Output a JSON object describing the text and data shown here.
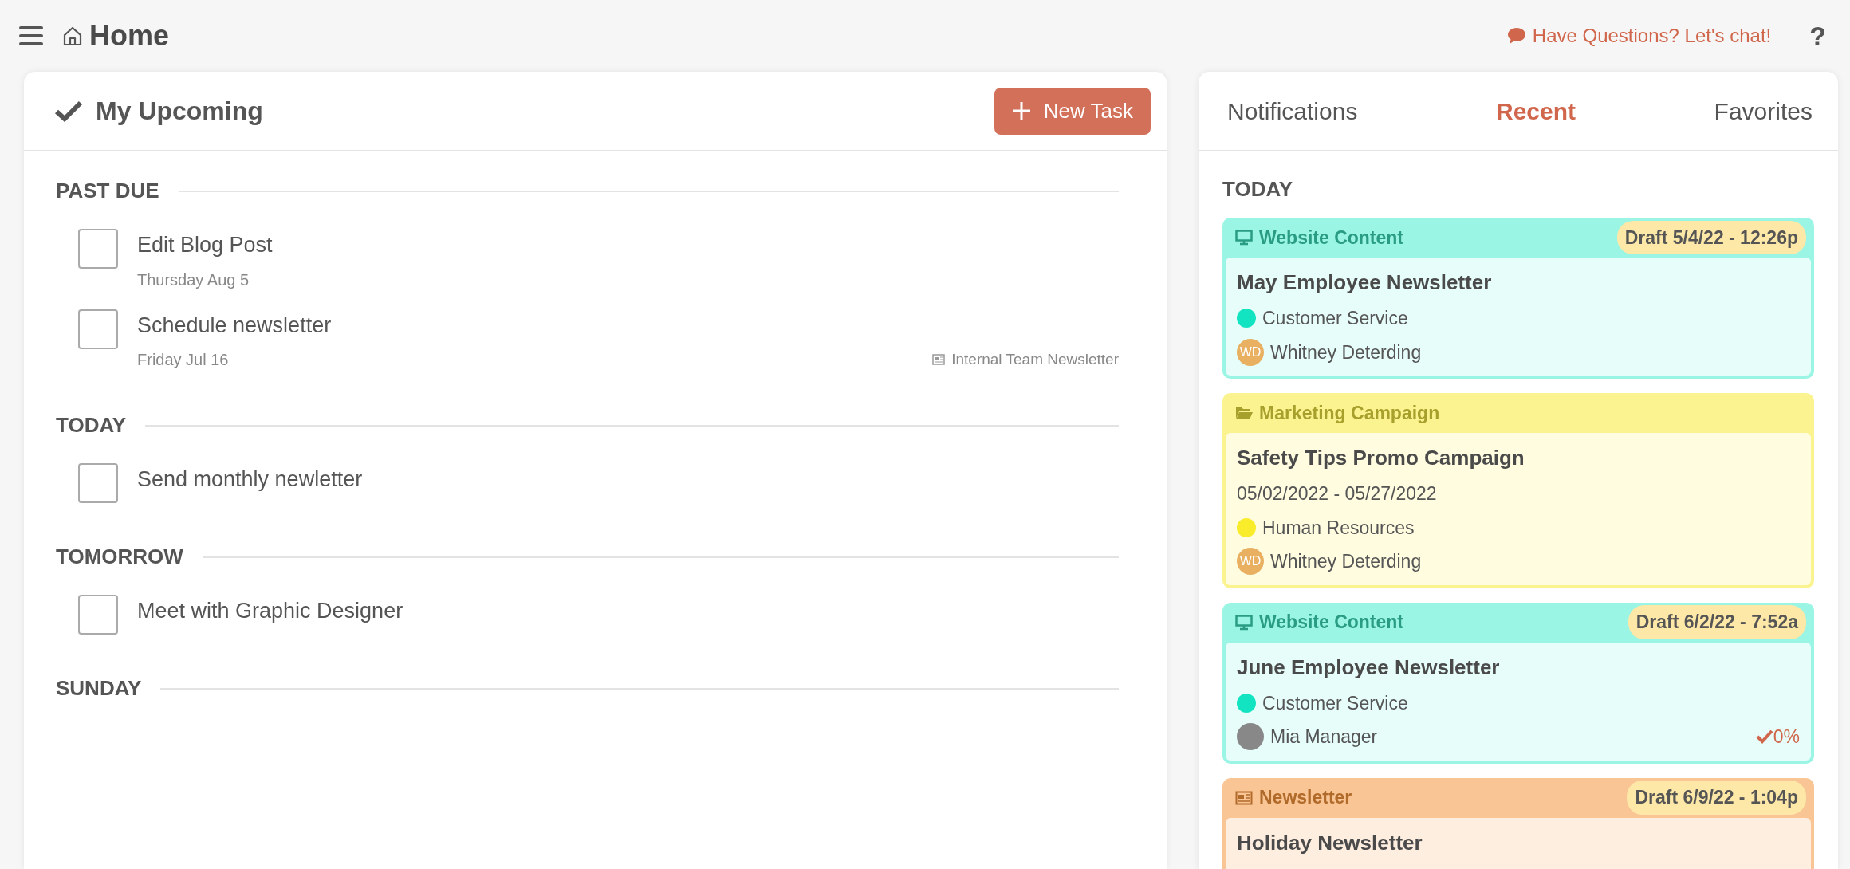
{
  "header": {
    "title": "Home",
    "chat_link": "Have Questions? Let's chat!",
    "help": "?"
  },
  "upcoming": {
    "title": "My Upcoming",
    "new_task_button": "New Task",
    "sections": [
      {
        "heading": "PAST DUE",
        "tasks": [
          {
            "title": "Edit Blog Post",
            "date": "Thursday Aug 5",
            "checked": false
          },
          {
            "title": "Schedule newsletter",
            "date": "Friday Jul 16",
            "project": "Internal Team Newsletter",
            "checked": false
          }
        ]
      },
      {
        "heading": "TODAY",
        "tasks": [
          {
            "title": "Send monthly newletter",
            "checked": false
          }
        ]
      },
      {
        "heading": "TOMORROW",
        "tasks": [
          {
            "title": "Meet with Graphic Designer",
            "checked": false
          }
        ]
      },
      {
        "heading": "SUNDAY"
      }
    ]
  },
  "activity": {
    "tabs": [
      {
        "label": "Notifications",
        "selected": false
      },
      {
        "label": "Recent",
        "selected": true
      },
      {
        "label": "Favorites",
        "selected": false
      }
    ],
    "group_heading": "TODAY",
    "cards": [
      {
        "kind": "website",
        "type_label": "Website Content",
        "status": "Draft",
        "timestamp": "5/4/22 - 12:26p",
        "title": "May Employee Newsletter",
        "team": "Customer Service",
        "color": "#12e3c0",
        "owner": "Whitney Deterding",
        "owner_initials": "WD"
      },
      {
        "kind": "campaign",
        "type_label": "Marketing Campaign",
        "title": "Safety Tips Promo Campaign",
        "dates": "05/02/2022 - 05/27/2022",
        "team": "Human Resources",
        "color": "#f9ec2a",
        "owner": "Whitney Deterding",
        "owner_initials": "WD"
      },
      {
        "kind": "website",
        "type_label": "Website Content",
        "status": "Draft",
        "timestamp": "6/2/22 - 7:52a",
        "title": "June Employee Newsletter",
        "team": "Customer Service",
        "color": "#12e3c0",
        "owner": "Mia Manager",
        "progress": "0%"
      },
      {
        "kind": "newsletter",
        "type_label": "Newsletter",
        "status": "Draft",
        "timestamp": "6/9/22 - 1:04p",
        "title": "Holiday Newsletter"
      }
    ]
  }
}
